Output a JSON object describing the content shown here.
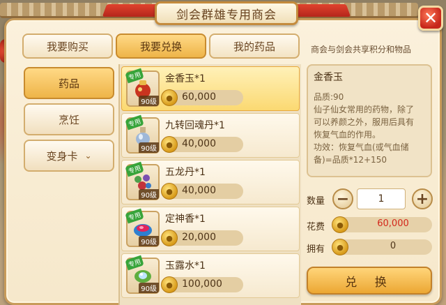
{
  "window": {
    "title": "剑会群雄专用商会",
    "close_label": "✕"
  },
  "tabs": [
    {
      "label": "我要购买",
      "active": false
    },
    {
      "label": "我要兑换",
      "active": true
    },
    {
      "label": "我的药品",
      "active": false
    }
  ],
  "tab_note": "商会与剑会共享积分和物品",
  "categories": [
    {
      "label": "药品",
      "active": true
    },
    {
      "label": "烹饪",
      "active": false
    },
    {
      "label": "变身卡",
      "active": false,
      "has_dropdown": true
    }
  ],
  "items": [
    {
      "name": "金香玉*1",
      "tag": "专用",
      "level": "90级",
      "price": "60,000",
      "icon": "pouch-icon",
      "selected": true
    },
    {
      "name": "九转回魂丹*1",
      "tag": "专用",
      "level": "90级",
      "price": "40,000",
      "icon": "potion-bottle-icon",
      "selected": false
    },
    {
      "name": "五龙丹*1",
      "tag": "专用",
      "level": "90级",
      "price": "40,000",
      "icon": "pills-icon",
      "selected": false
    },
    {
      "name": "定神香*1",
      "tag": "专用",
      "level": "90级",
      "price": "20,000",
      "icon": "incense-bowl-icon",
      "selected": false
    },
    {
      "name": "玉露水*1",
      "tag": "专用",
      "level": "90级",
      "price": "100,000",
      "icon": "leaf-dew-icon",
      "selected": false
    }
  ],
  "detail": {
    "title": "金香玉",
    "quality": "品质:90",
    "desc_lines": [
      "仙子仙女常用的药物，除了",
      "可以养颜之外，服用后具有",
      "恢复气血的作用。"
    ],
    "effect_lines": [
      "功效：恢复气血(或气血储",
      "备)=品质*12+150"
    ]
  },
  "purchase": {
    "qty_label": "数量",
    "qty_value": "1",
    "cost_label": "花费",
    "cost_value": "60,000",
    "own_label": "拥有",
    "own_value": "0",
    "exchange_label": "兑 换"
  },
  "colors": {
    "accent": "#eeb448",
    "cost_red": "#d3261b",
    "selected_item": "#fbd972"
  }
}
